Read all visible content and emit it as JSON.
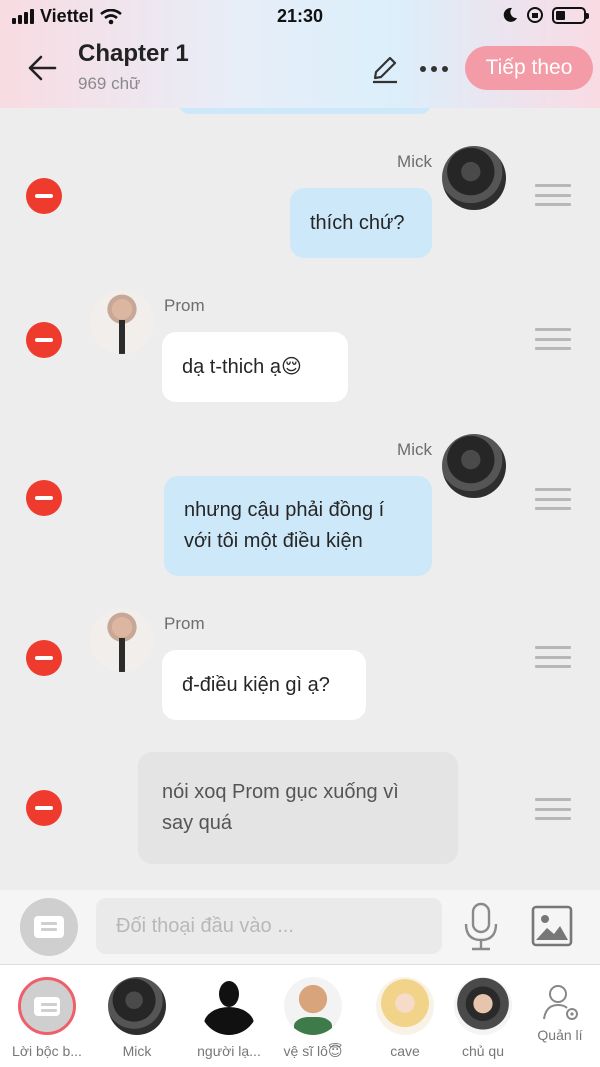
{
  "status_bar": {
    "carrier": "Viettel",
    "time": "21:30"
  },
  "header": {
    "title": "Chapter 1",
    "word_count": "969 chữ",
    "next_button": "Tiếp theo"
  },
  "messages": [
    {
      "speaker": "Mick",
      "side": "right",
      "text": "thích chứ?"
    },
    {
      "speaker": "Prom",
      "side": "left",
      "text": "dạ t-thich ạ😌"
    },
    {
      "speaker": "Mick",
      "side": "right",
      "lines": [
        "nhưng cậu phải đồng í",
        "với tôi một điều kiện"
      ]
    },
    {
      "speaker": "Prom",
      "side": "left",
      "text": "đ-điều kiện gì ạ?"
    },
    {
      "speaker": "",
      "side": "narration",
      "lines": [
        "nói xoq Prom gục xuống vì",
        "say quá"
      ]
    }
  ],
  "input_bar": {
    "placeholder": "Đối thoại đầu vào ..."
  },
  "characters": [
    {
      "label": "Lời bộc b...",
      "selected": true
    },
    {
      "label": "Mick"
    },
    {
      "label": "người lạ..."
    },
    {
      "label": "vệ sĩ lô😇"
    },
    {
      "label": "cave"
    },
    {
      "label": "chủ qu"
    }
  ],
  "manage_label": "Quản lí",
  "colors": {
    "accent": "#f49ba8",
    "delete": "#ef3a2e",
    "mick_bubble": "#cde8f8",
    "prom_bubble": "#ffffff",
    "narration_bubble": "#e4e4e4"
  }
}
